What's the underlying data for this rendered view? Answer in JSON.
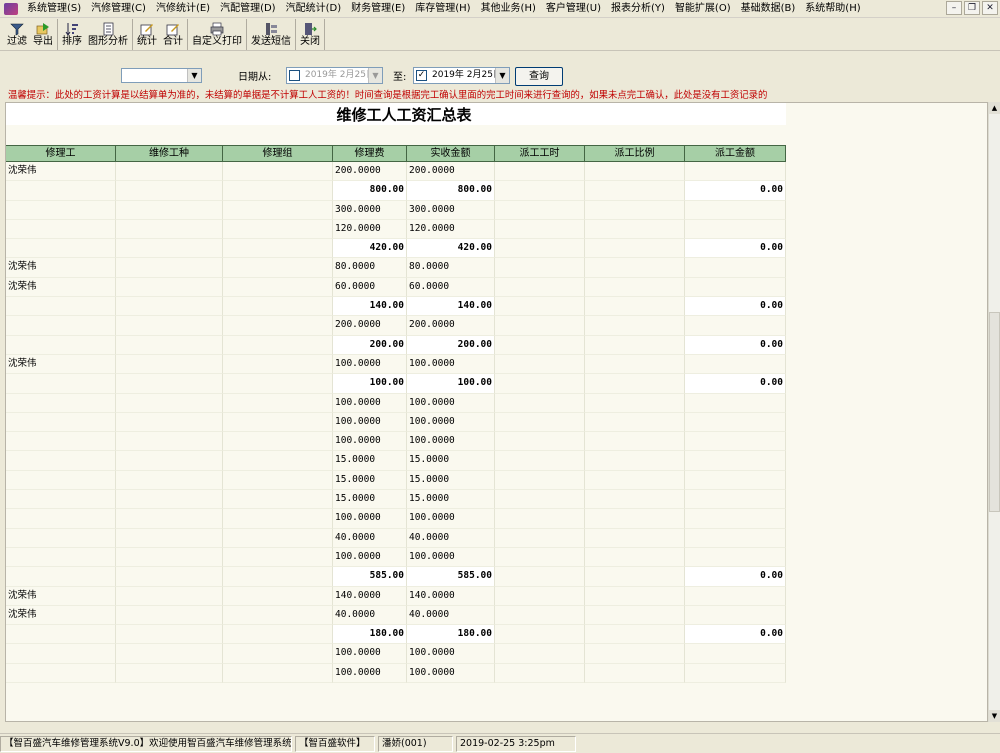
{
  "menu": {
    "items": [
      "系统管理(S)",
      "汽修管理(C)",
      "汽修统计(E)",
      "汽配管理(D)",
      "汽配统计(D)",
      "财务管理(E)",
      "库存管理(H)",
      "其他业务(H)",
      "客户管理(U)",
      "报表分析(Y)",
      "智能扩展(O)",
      "基础数据(B)",
      "系统帮助(H)"
    ],
    "window_controls": [
      "–",
      "❐",
      "✕"
    ]
  },
  "toolbar": {
    "filter": "过滤",
    "export": "导出",
    "sort": "排序",
    "graph": "图形分析",
    "stats": "统计",
    "total": "合计",
    "custom_print": "自定义打印",
    "send_sms": "发送短信",
    "close": "关闭"
  },
  "filters": {
    "combo_value": "",
    "date_from_label": "日期从:",
    "date_from": "2019年 2月25日",
    "date_to_label": "至:",
    "date_to": "2019年 2月25日",
    "query_button": "查询",
    "hint": "温馨提示：此处的工资计算是以结算单为准的，未结算的单据是不计算工人工资的！时间查询是根据完工确认里面的完工时间来进行查询的，如果未点完工确认，此处是没有工资记录的"
  },
  "report": {
    "title": "维修工人工资汇总表",
    "columns": [
      "修理工",
      "维修工种",
      "修理组",
      "修理费",
      "实收金额",
      "派工工时",
      "派工比例",
      "派工金额"
    ],
    "rows": [
      {
        "type": "detail",
        "name": "沈荣伟",
        "fee": "200.0000",
        "received": "200.0000"
      },
      {
        "type": "subtotal",
        "fee": "800.00",
        "received": "800.00",
        "amount": "0.00"
      },
      {
        "type": "detail",
        "name": "",
        "fee": "300.0000",
        "received": "300.0000"
      },
      {
        "type": "detail",
        "name": "",
        "fee": "120.0000",
        "received": "120.0000"
      },
      {
        "type": "subtotal",
        "fee": "420.00",
        "received": "420.00",
        "amount": "0.00"
      },
      {
        "type": "detail",
        "name": "沈荣伟",
        "fee": "80.0000",
        "received": "80.0000"
      },
      {
        "type": "detail",
        "name": "沈荣伟",
        "fee": "60.0000",
        "received": "60.0000"
      },
      {
        "type": "subtotal",
        "fee": "140.00",
        "received": "140.00",
        "amount": "0.00"
      },
      {
        "type": "detail",
        "name": "",
        "fee": "200.0000",
        "received": "200.0000"
      },
      {
        "type": "subtotal",
        "fee": "200.00",
        "received": "200.00",
        "amount": "0.00"
      },
      {
        "type": "detail",
        "name": "沈荣伟",
        "fee": "100.0000",
        "received": "100.0000"
      },
      {
        "type": "subtotal",
        "fee": "100.00",
        "received": "100.00",
        "amount": "0.00"
      },
      {
        "type": "detail",
        "name": "",
        "fee": "100.0000",
        "received": "100.0000"
      },
      {
        "type": "detail",
        "name": "",
        "fee": "100.0000",
        "received": "100.0000"
      },
      {
        "type": "detail",
        "name": "",
        "fee": "100.0000",
        "received": "100.0000"
      },
      {
        "type": "detail",
        "name": "",
        "fee": "15.0000",
        "received": "15.0000"
      },
      {
        "type": "detail",
        "name": "",
        "fee": "15.0000",
        "received": "15.0000"
      },
      {
        "type": "detail",
        "name": "",
        "fee": "15.0000",
        "received": "15.0000"
      },
      {
        "type": "detail",
        "name": "",
        "fee": "100.0000",
        "received": "100.0000"
      },
      {
        "type": "detail",
        "name": "",
        "fee": "40.0000",
        "received": "40.0000"
      },
      {
        "type": "detail",
        "name": "",
        "fee": "100.0000",
        "received": "100.0000"
      },
      {
        "type": "subtotal",
        "fee": "585.00",
        "received": "585.00",
        "amount": "0.00"
      },
      {
        "type": "detail",
        "name": "沈荣伟",
        "fee": "140.0000",
        "received": "140.0000"
      },
      {
        "type": "detail",
        "name": "沈荣伟",
        "fee": "40.0000",
        "received": "40.0000"
      },
      {
        "type": "subtotal",
        "fee": "180.00",
        "received": "180.00",
        "amount": "0.00"
      },
      {
        "type": "detail",
        "name": "",
        "fee": "100.0000",
        "received": "100.0000"
      },
      {
        "type": "detail",
        "name": "",
        "fee": "100.0000",
        "received": "100.0000"
      }
    ]
  },
  "statusbar": {
    "app": "【智百盛汽车维修管理系统V9.0】欢迎使用智百盛汽车维修管理系统...",
    "company": "【智百盛软件】",
    "user": "潘娇(001)",
    "datetime": "2019-02-25  3:25pm"
  },
  "colors": {
    "header_bg": "#a6cfa6",
    "hint_text": "#c00000",
    "report_bg": "#faf9ef"
  }
}
